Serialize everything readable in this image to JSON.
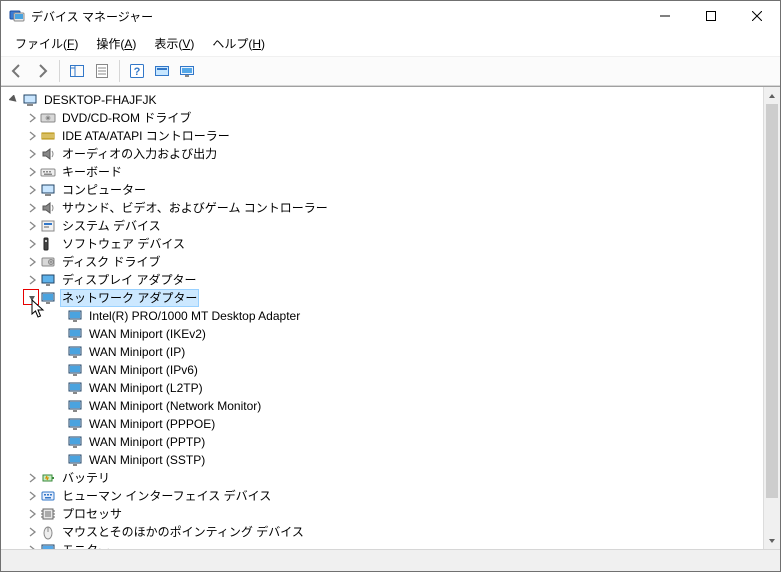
{
  "window": {
    "title": "デバイス マネージャー"
  },
  "menubar": {
    "file": "ファイル(",
    "file_key": "F",
    "action": "操作(",
    "action_key": "A",
    "view": "表示(",
    "view_key": "V",
    "help": "ヘルプ(",
    "help_key": "H",
    "close_paren": ")"
  },
  "toolbar": {
    "back": "back-icon",
    "forward": "forward-icon",
    "show_hide_tree": "show-hide-tree-icon",
    "properties": "properties-icon",
    "help": "help-icon",
    "scan": "scan-hardware-icon",
    "show_hidden": "show-hidden-devices-icon"
  },
  "tree": {
    "root": "DESKTOP-FHAJFJK",
    "nodes": {
      "n0": {
        "label": "DVD/CD-ROM ドライブ",
        "icon": "optical-drive"
      },
      "n1": {
        "label": "IDE ATA/ATAPI コントローラー",
        "icon": "ide-controller"
      },
      "n2": {
        "label": "オーディオの入力および出力",
        "icon": "audio"
      },
      "n3": {
        "label": "キーボード",
        "icon": "keyboard"
      },
      "n4": {
        "label": "コンピューター",
        "icon": "computer"
      },
      "n5": {
        "label": "サウンド、ビデオ、およびゲーム コントローラー",
        "icon": "audio"
      },
      "n6": {
        "label": "システム デバイス",
        "icon": "system"
      },
      "n7": {
        "label": "ソフトウェア デバイス",
        "icon": "software"
      },
      "n8": {
        "label": "ディスク ドライブ",
        "icon": "disk"
      },
      "n9": {
        "label": "ディスプレイ アダプター",
        "icon": "display"
      },
      "n10": {
        "label": "ネットワーク アダプター",
        "icon": "network"
      },
      "n11": {
        "label": "バッテリ",
        "icon": "battery"
      },
      "n12": {
        "label": "ヒューマン インターフェイス デバイス",
        "icon": "hid"
      },
      "n13": {
        "label": "プロセッサ",
        "icon": "processor"
      },
      "n14": {
        "label": "マウスとそのほかのポインティング デバイス",
        "icon": "mouse"
      },
      "n15": {
        "label": "モニター",
        "icon": "monitor"
      }
    },
    "network_children": {
      "c0": "Intel(R) PRO/1000 MT Desktop Adapter",
      "c1": "WAN Miniport (IKEv2)",
      "c2": "WAN Miniport (IP)",
      "c3": "WAN Miniport (IPv6)",
      "c4": "WAN Miniport (L2TP)",
      "c5": "WAN Miniport (Network Monitor)",
      "c6": "WAN Miniport (PPPOE)",
      "c7": "WAN Miniport (PPTP)",
      "c8": "WAN Miniport (SSTP)"
    }
  },
  "selected_node": "n10",
  "highlighted_expander": "n10"
}
